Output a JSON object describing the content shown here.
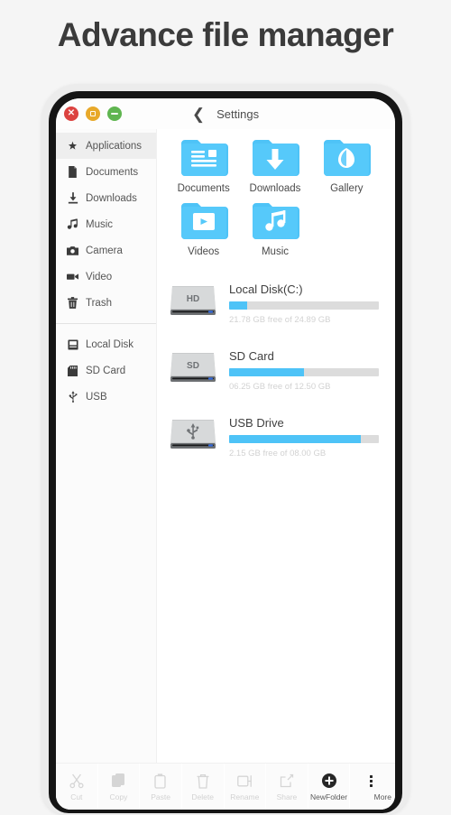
{
  "page": {
    "heading": "Advance file manager"
  },
  "window": {
    "controls": [
      {
        "name": "close",
        "glyph": "×",
        "color": "#dc4340"
      },
      {
        "name": "minimize",
        "glyph": "□",
        "color": "#e8a92a"
      },
      {
        "name": "maximize",
        "glyph": "–",
        "color": "#5fb550"
      }
    ],
    "back_icon": "‹",
    "title": "Settings"
  },
  "sidebar": {
    "groups": [
      {
        "items": [
          {
            "label": "Applications",
            "icon": "applications-icon",
            "active": true
          },
          {
            "label": "Documents",
            "icon": "document-icon",
            "active": false
          },
          {
            "label": "Downloads",
            "icon": "download-icon",
            "active": false
          },
          {
            "label": "Music",
            "icon": "music-note-icon",
            "active": false
          },
          {
            "label": "Camera",
            "icon": "camera-icon",
            "active": false
          },
          {
            "label": "Video",
            "icon": "video-camera-icon",
            "active": false
          },
          {
            "label": "Trash",
            "icon": "trash-icon",
            "active": false
          }
        ]
      },
      {
        "items": [
          {
            "label": "Local Disk",
            "icon": "hard-disk-icon",
            "active": false
          },
          {
            "label": "SD Card",
            "icon": "sd-card-icon",
            "active": false
          },
          {
            "label": "USB",
            "icon": "usb-icon",
            "active": false
          }
        ]
      }
    ]
  },
  "main": {
    "folders": [
      {
        "label": "Documents",
        "icon": "folder-documents-icon"
      },
      {
        "label": "Downloads",
        "icon": "folder-downloads-icon"
      },
      {
        "label": "Gallery",
        "icon": "folder-gallery-icon"
      },
      {
        "label": "Videos",
        "icon": "folder-videos-icon"
      },
      {
        "label": "Music",
        "icon": "folder-music-icon"
      }
    ],
    "drives": [
      {
        "name": "Local Disk(C:)",
        "badge": "HD",
        "icon": "hard-drive-icon",
        "usage_percent": 12,
        "detail": "21.78 GB free of 24.89 GB"
      },
      {
        "name": "SD Card",
        "badge": "SD",
        "icon": "sd-drive-icon",
        "usage_percent": 50,
        "detail": "06.25 GB free of 12.50 GB"
      },
      {
        "name": "USB Drive",
        "badge": "USB",
        "icon": "usb-drive-icon",
        "usage_percent": 88,
        "detail": "2.15 GB free of 08.00 GB"
      }
    ]
  },
  "toolbar": {
    "buttons": [
      {
        "label": "Cut",
        "icon": "scissors-icon",
        "enabled": false
      },
      {
        "label": "Copy",
        "icon": "copy-icon",
        "enabled": false
      },
      {
        "label": "Paste",
        "icon": "paste-icon",
        "enabled": false
      },
      {
        "label": "Delete",
        "icon": "trash-icon",
        "enabled": false
      },
      {
        "label": "Rename",
        "icon": "rename-icon",
        "enabled": false
      },
      {
        "label": "Share",
        "icon": "share-icon",
        "enabled": false
      },
      {
        "label": "NewFolder",
        "icon": "plus-circle-icon",
        "enabled": true
      },
      {
        "label": "More",
        "icon": "overflow-dots-icon",
        "enabled": true
      }
    ]
  },
  "colors": {
    "accent": "#4ec3f7",
    "folder_blue": "#4ec3f7",
    "track": "#dcdcdc",
    "text": "#4a4a4a"
  }
}
